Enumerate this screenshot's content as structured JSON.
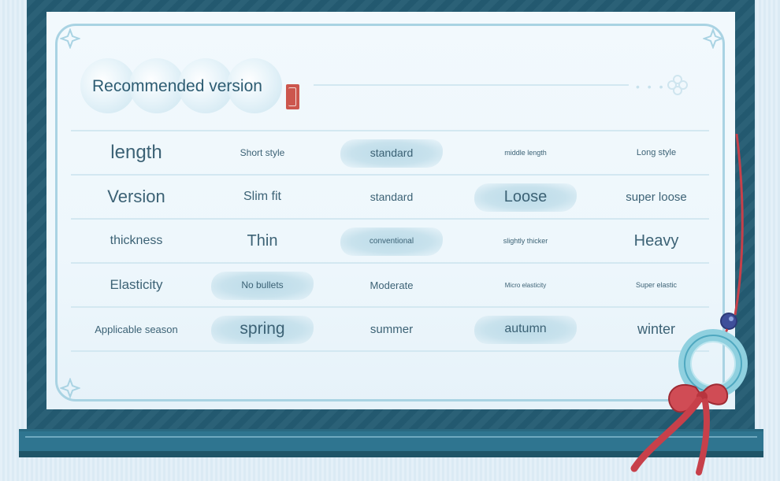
{
  "header": {
    "title": "Recommended version"
  },
  "rows": [
    {
      "label": "length",
      "options": [
        "Short style",
        "standard",
        "middle length",
        "Long style"
      ]
    },
    {
      "label": "Version",
      "options": [
        "Slim fit",
        "standard",
        "Loose",
        "super loose"
      ]
    },
    {
      "label": "thickness",
      "options": [
        "Thin",
        "conventional",
        "slightly thicker",
        "Heavy"
      ]
    },
    {
      "label": "Elasticity",
      "options": [
        "No bullets",
        "Moderate",
        "Micro elasticity",
        "Super elastic"
      ]
    },
    {
      "label": "Applicable season",
      "options": [
        "spring",
        "summer",
        "autumn",
        "winter"
      ]
    }
  ],
  "selected": {
    "length": [
      "standard"
    ],
    "Version": [
      "Loose"
    ],
    "thickness": [
      "conventional"
    ],
    "Elasticity": [
      "No bullets"
    ],
    "Applicable season": [
      "spring",
      "autumn"
    ]
  },
  "colors": {
    "frame": "#245c73",
    "paper": "#eef7fc",
    "highlight": "#c8e2ed",
    "text": "#3c6275",
    "tassel": "#c7404a"
  }
}
